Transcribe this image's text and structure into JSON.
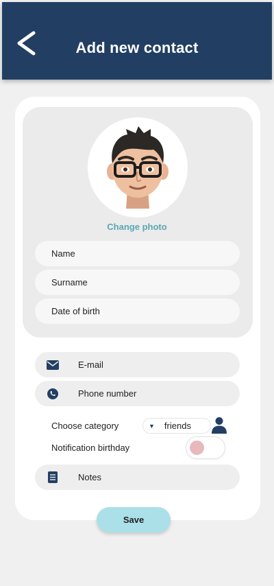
{
  "header": {
    "title": "Add new contact",
    "back_icon": "chevron-left-icon",
    "background": "#223f63"
  },
  "profile": {
    "avatar_icon": "memoji-avatar",
    "change_photo_label": "Change photo"
  },
  "fields": {
    "name_placeholder": "Name",
    "surname_placeholder": "Surname",
    "dob_placeholder": "Date of birth",
    "email_placeholder": "E-mail",
    "phone_placeholder": "Phone number",
    "notes_placeholder": "Notes"
  },
  "category": {
    "label": "Choose category",
    "selected": "friends",
    "icon": "person-icon"
  },
  "notification": {
    "label": "Notification birthday",
    "enabled": false,
    "knob_color": "#e8b8bd"
  },
  "save_label": "Save",
  "colors": {
    "accent": "#5aa6b3",
    "save_button": "#ace0e8",
    "dark_blue": "#223f63"
  }
}
